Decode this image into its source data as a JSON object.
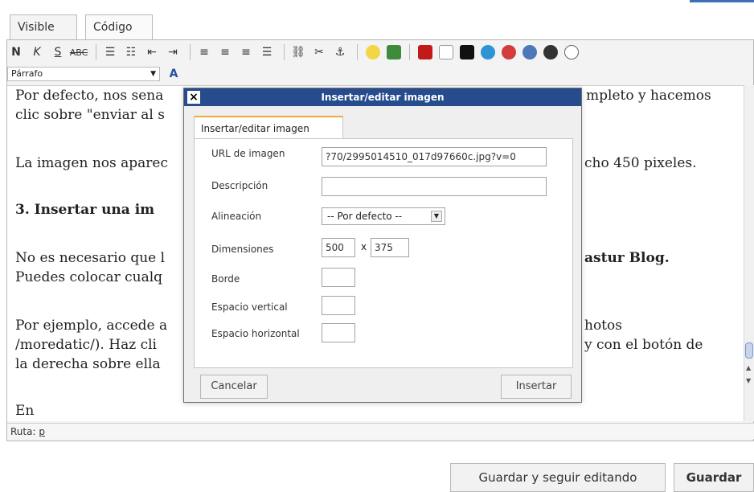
{
  "window": {
    "accent_color": "#3b6fb6"
  },
  "tabs": {
    "visible_label": "Visible",
    "code_label": "Código"
  },
  "toolbar": {
    "row1_icons": [
      "bold-icon",
      "italic-icon",
      "underline-icon",
      "strikethrough-icon",
      "bullets-icon",
      "numbering-icon",
      "outdent-icon",
      "indent-icon",
      "align-left-icon",
      "align-center-icon",
      "align-right-icon",
      "justify-icon",
      "link-icon",
      "unlink-icon",
      "anchor-icon",
      "emoji-icon",
      "image-icon",
      "youtube-icon",
      "google-icon",
      "info-icon",
      "search-icon",
      "stop-icon",
      "play-icon",
      "audio-icon",
      "rotate-icon"
    ],
    "row2": {
      "format_value": "Párrafo",
      "format_label": "Párrafo"
    }
  },
  "editor": {
    "paragraphs": [
      "Por defecto, nos sena",
      "clic sobre \"enviar al s",
      "La imagen nos aparec",
      "3. Insertar una im",
      "No es necesario que l",
      "Puedes colocar cualq",
      "Por ejemplo, accede a",
      "/moredatic/). Haz cli",
      "la derecha sobre ella",
      "En"
    ],
    "right_fragments": [
      "mpleto y hacemos",
      "cho 450 pixeles.",
      "astur Blog.",
      "hotos",
      "y con el botón de"
    ]
  },
  "status": {
    "path_label": "Ruta:",
    "path_value": "p"
  },
  "dialog": {
    "title": "Insertar/editar imagen",
    "tab_label": "Insertar/editar imagen",
    "fields": [
      {
        "label": "URL de imagen",
        "value": "?70/2995014510_017d97660c.jpg?v=0",
        "placeholder": ""
      },
      {
        "label": "Descripción",
        "value": "",
        "placeholder": ""
      },
      {
        "label": "Alineación",
        "value": "-- Por defecto --",
        "placeholder": ""
      },
      {
        "label": "Dimensiones",
        "value": "500",
        "placeholder": ""
      },
      {
        "label": "Borde",
        "value": "",
        "placeholder": ""
      },
      {
        "label": "Espacio vertical",
        "value": "",
        "placeholder": ""
      },
      {
        "label": "Espacio horizontal",
        "value": "",
        "placeholder": ""
      }
    ],
    "dim_separator": "x",
    "height_value": "375",
    "buttons": {
      "cancel": "Cancelar",
      "insert": "Insertar"
    }
  },
  "footer": {
    "save_continue": "Guardar y seguir editando",
    "save": "Guardar"
  },
  "colors": {
    "title_bar": "#264c8e",
    "tab_accent": "#f1aa3a"
  }
}
